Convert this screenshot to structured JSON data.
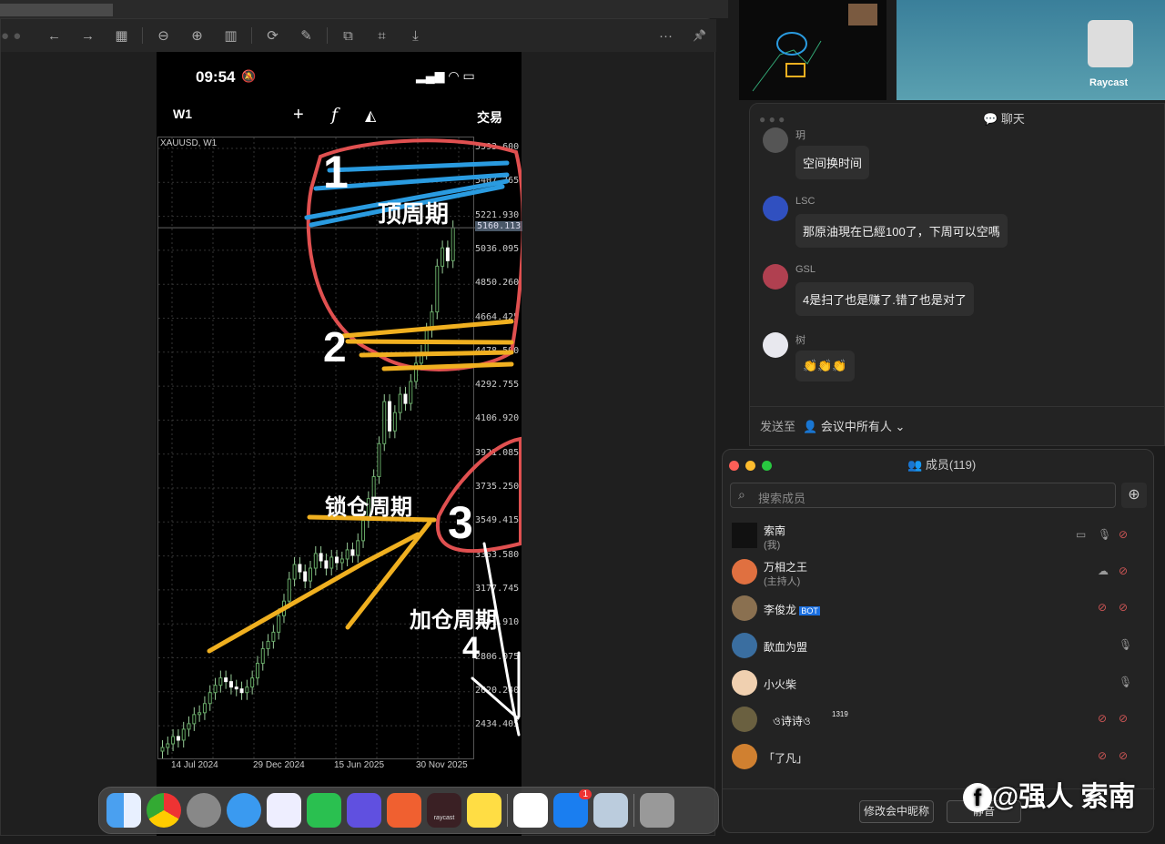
{
  "viewer": {
    "toolbar": [
      "←",
      "→",
      "▦",
      "⊖",
      "⊕",
      "▥",
      "⟳",
      "✎",
      "⧉",
      "⌗",
      "⤓",
      "···",
      "📌"
    ]
  },
  "phone": {
    "time": "09:54",
    "timeframe": "W1",
    "trade": "交易",
    "symbol": "XAUUSD, W1",
    "current_price": "5160.113",
    "price_labels": [
      "5593.600",
      "5407.765",
      "5221.930",
      "5036.095",
      "4850.260",
      "4664.425",
      "4478.590",
      "4292.755",
      "4106.920",
      "3921.085",
      "3735.250",
      "3549.415",
      "3363.580",
      "3177.745",
      "2991.910",
      "2806.075",
      "2620.240",
      "2434.405"
    ],
    "date_labels": [
      "14 Jul 2024",
      "29 Dec 2024",
      "15 Jun 2025",
      "30 Nov 2025"
    ],
    "annotations": {
      "n1": "1",
      "top": "顶周期",
      "n2": "2",
      "lock": "锁仓周期",
      "n3": "3",
      "add": "加仓周期",
      "n4": "4"
    }
  },
  "chart_data": {
    "type": "candlestick",
    "symbol": "XAUUSD",
    "timeframe": "W1",
    "ylim": [
      2434.405,
      5593.6
    ],
    "closes": [
      2320,
      2340,
      2380,
      2360,
      2420,
      2450,
      2500,
      2510,
      2560,
      2620,
      2660,
      2700,
      2680,
      2650,
      2640,
      2620,
      2650,
      2700,
      2780,
      2860,
      2900,
      2950,
      3040,
      3120,
      3240,
      3320,
      3280,
      3230,
      3300,
      3380,
      3340,
      3300,
      3360,
      3330,
      3350,
      3400,
      3370,
      3450,
      3560,
      3680,
      3800,
      3980,
      4210,
      4050,
      4150,
      4250,
      4200,
      4320,
      4420,
      4480,
      4600,
      4700,
      4950,
      5050,
      4980,
      5160
    ]
  },
  "chat": {
    "title": "聊天",
    "messages": [
      {
        "name": "玥",
        "text": "空间换时间"
      },
      {
        "name": "LSC",
        "text": "那原油現在已經100了，下周可以空嗎"
      },
      {
        "name": "GSL",
        "text": "4是扫了也是赚了.错了也是对了"
      },
      {
        "name": "树",
        "text": "👏👏👏"
      }
    ],
    "send_to_label": "发送至",
    "send_to_value": "会议中所有人"
  },
  "members": {
    "title": "成员(119)",
    "search_placeholder": "搜索成员",
    "list": [
      {
        "name": "索南",
        "sub": "(我)"
      },
      {
        "name": "万相之王",
        "sub": "(主持人)"
      },
      {
        "name": "李俊龙",
        "badge": "BOT"
      },
      {
        "name": "歃血为盟"
      },
      {
        "name": "小火柴"
      },
      {
        "name": "ও诗诗ও",
        "extra": "1319"
      },
      {
        "name": "「了凡」"
      }
    ],
    "rename_btn": "修改会中昵称",
    "mute_btn": "静音"
  },
  "desktop": {
    "raycast_label": "Raycast"
  },
  "dock": {
    "badge": "1",
    "apps": [
      "finder",
      "chrome",
      "settings",
      "safari",
      "windows",
      "wechat",
      "link",
      "brave",
      "raycast",
      "notes",
      "qq",
      "lark",
      "preview",
      "trash"
    ],
    "raycast_text": "raycast"
  },
  "watermark": "@强人 索南"
}
